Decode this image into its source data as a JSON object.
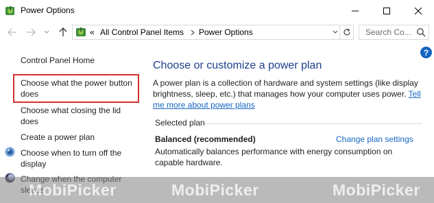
{
  "window": {
    "title": "Power Options",
    "controls": [
      "minimize-icon",
      "maximize-icon",
      "close-icon"
    ]
  },
  "address_bar": {
    "prefix": "«",
    "breadcrumbs": [
      "All Control Panel Items",
      "Power Options"
    ],
    "search_placeholder": "Search Co..."
  },
  "left_pane": {
    "home": "Control Panel Home",
    "links": [
      {
        "line1": "Choose what the power button",
        "line2": "does",
        "highlighted": true
      },
      {
        "line1": "Choose what closing the lid",
        "line2": "does"
      },
      {
        "line1": "Create a power plan"
      },
      {
        "line1": "Choose when to turn off the",
        "line2": "display",
        "icon": "shield-icon"
      },
      {
        "line1": "Change when the computer",
        "line2": "sleeps",
        "icon": "shield-icon"
      }
    ]
  },
  "main": {
    "title": "Choose or customize a power plan",
    "desc_text": "A power plan is a collection of hardware and system settings (like display brightness, sleep, etc.) that manages how your computer uses power. ",
    "desc_link": "Tell me more about power plans",
    "selected_label": "Selected plan",
    "plan_name": "Balanced (recommended)",
    "plan_link": "Change plan settings",
    "plan_desc": "Automatically balances performance with energy consumption on capable hardware."
  },
  "help_label": "?",
  "watermark": [
    "MobiPicker",
    "MobiPicker",
    "MobiPicker"
  ],
  "colors": {
    "accent": "#1565c0",
    "title_blue": "#1c3d8c",
    "highlight_border": "#d32f2f"
  }
}
